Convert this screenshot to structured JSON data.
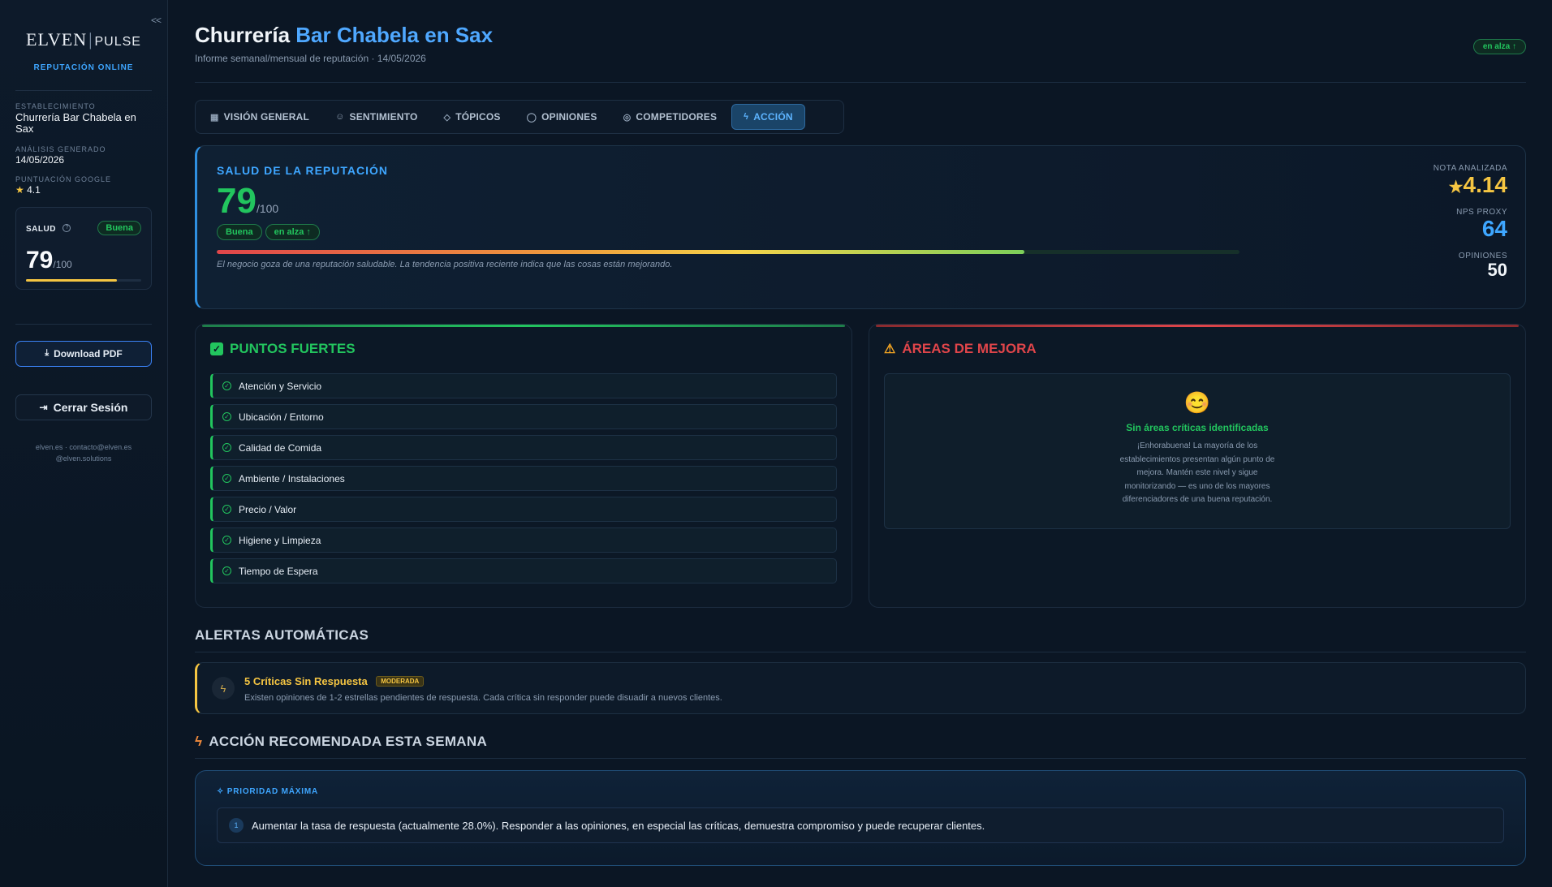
{
  "sidebar": {
    "collapse_label": "<<",
    "logo_left": "ELVEN",
    "logo_sep": "|",
    "logo_right": "PULSE",
    "subtitle": "REPUTACIÓN ONLINE",
    "establishment_label": "ESTABLECIMIENTO",
    "establishment_value": "Churrería Bar Chabela en Sax",
    "analysis_label": "ANÁLISIS GENERADO",
    "analysis_value": "14/05/2026",
    "google_label": "PUNTUACIÓN GOOGLE",
    "google_value": "4.1",
    "health": {
      "label": "SALUD",
      "badge": "Buena",
      "score": "79",
      "denominator": "/100",
      "progress_fraction": 0.79
    },
    "download_label": "Download PDF",
    "logout_label": "Cerrar Sesión",
    "footer_line1": "elven.es · contacto@elven.es",
    "footer_line2": "@elven.solutions"
  },
  "header": {
    "title_part1": "Churrería",
    "title_part2": "Bar",
    "title_part3": "Chabela en Sax",
    "subtitle": "Informe semanal/mensual de reputación · 14/05/2026",
    "trend": "en alza ↑"
  },
  "tabs": [
    {
      "icon": "▦",
      "label": "VISIÓN GENERAL"
    },
    {
      "icon": "☺",
      "label": "SENTIMIENTO"
    },
    {
      "icon": "◇",
      "label": "TÓPICOS"
    },
    {
      "icon": "◯",
      "label": "OPINIONES"
    },
    {
      "icon": "◎",
      "label": "COMPETIDORES"
    },
    {
      "icon": "ϟ",
      "label": "ACCIÓN"
    }
  ],
  "reputation": {
    "title": "SALUD DE LA REPUTACIÓN",
    "score": "79",
    "denominator": "/100",
    "badge1": "Buena",
    "badge2": "en alza ↑",
    "progress_fraction": 0.79,
    "note": "El negocio goza de una reputación saludable. La tendencia positiva reciente indica que las cosas están mejorando.",
    "rating_label": "NOTA ANALIZADA",
    "rating_value": "4.14",
    "nps_label": "NPS PROXY",
    "nps_value": "64",
    "opinions_label": "OPINIONES",
    "opinions_value": "50"
  },
  "strengths": {
    "title": "PUNTOS FUERTES",
    "items": [
      "Atención y Servicio",
      "Ubicación / Entorno",
      "Calidad de Comida",
      "Ambiente / Instalaciones",
      "Precio / Valor",
      "Higiene y Limpieza",
      "Tiempo de Espera"
    ]
  },
  "improvements": {
    "title": "ÁREAS DE MEJORA",
    "emoji": "😊",
    "empty_title": "Sin áreas críticas identificadas",
    "empty_text": "¡Enhorabuena! La mayoría de los establecimientos presentan algún punto de mejora. Mantén este nivel y sigue monitorizando — es uno de los mayores diferenciadores de una buena reputación."
  },
  "alerts": {
    "title": "ALERTAS AUTOMÁTICAS",
    "items": [
      {
        "title": "5 Críticas Sin Respuesta",
        "badge": "MODERADA",
        "text": "Existen opiniones de 1-2 estrellas pendientes de respuesta. Cada crítica sin responder puede disuadir a nuevos clientes."
      }
    ]
  },
  "action": {
    "title": "ACCIÓN RECOMENDADA ESTA SEMANA",
    "priority": "PRIORIDAD MÁXIMA",
    "items": [
      {
        "number": "1",
        "text": "Aumentar la tasa de respuesta (actualmente 28.0%). Responder a las opiniones, en especial las críticas, demuestra compromiso y puede recuperar clientes."
      }
    ]
  },
  "colors": {
    "accent": "#3ea6ff",
    "good": "#22c55e",
    "warning": "#f5c542",
    "bad": "#e0454a",
    "background": "#0b1624"
  }
}
